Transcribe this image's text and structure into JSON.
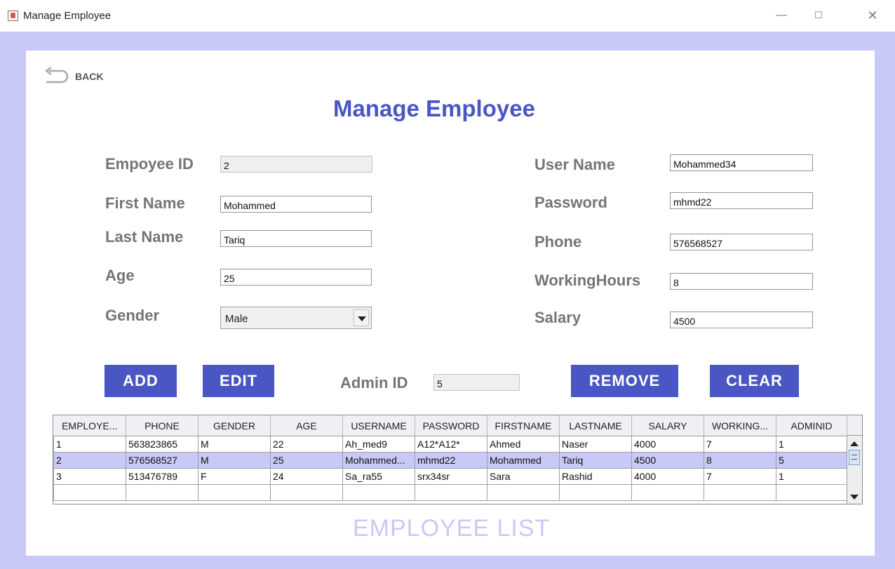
{
  "window": {
    "title": "Manage Employee",
    "minimize_icon": "minimize-icon",
    "maximize_icon": "maximize-icon",
    "close_icon": "close-icon"
  },
  "back": {
    "label": "BACK",
    "icon": "back-arrow-icon"
  },
  "page_title": "Manage Employee",
  "form": {
    "employee_id": {
      "label": "Empoyee ID",
      "value": "2"
    },
    "first_name": {
      "label": "First Name",
      "value": "Mohammed"
    },
    "last_name": {
      "label": "Last Name",
      "value": "Tariq"
    },
    "age": {
      "label": "Age",
      "value": "25"
    },
    "gender": {
      "label": "Gender",
      "value": "Male"
    },
    "user_name": {
      "label": "User Name",
      "value": "Mohammed34"
    },
    "password": {
      "label": "Password",
      "value": "mhmd22"
    },
    "phone": {
      "label": "Phone",
      "value": "576568527"
    },
    "working_hours": {
      "label": "WorkingHours",
      "value": "8"
    },
    "salary": {
      "label": "Salary",
      "value": "4500"
    }
  },
  "buttons": {
    "add": "ADD",
    "edit": "EDIT",
    "remove": "REMOVE",
    "clear": "CLEAR"
  },
  "admin": {
    "label": "Admin ID",
    "value": "5"
  },
  "table": {
    "columns": [
      "EMPLOYE...",
      "PHONE",
      "GENDER",
      "AGE",
      "USERNAME",
      "PASSWORD",
      "FIRSTNAME",
      "LASTNAME",
      "SALARY",
      "WORKING...",
      "ADMINID"
    ],
    "rows": [
      [
        "1",
        "563823865",
        "M",
        "22",
        "Ah_med9",
        "A12*A12*",
        "Ahmed",
        "Naser",
        "4000",
        "7",
        "1"
      ],
      [
        "2",
        "576568527",
        "M",
        "25",
        "Mohammed...",
        "mhmd22",
        "Mohammed",
        "Tariq",
        "4500",
        "8",
        "5"
      ],
      [
        "3",
        "513476789",
        "F",
        "24",
        "Sa_ra55",
        "srx34sr",
        "Sara",
        "Rashid",
        "4000",
        "7",
        "1"
      ]
    ],
    "selected_row": 1
  },
  "list_caption": "EMPLOYEE LIST"
}
